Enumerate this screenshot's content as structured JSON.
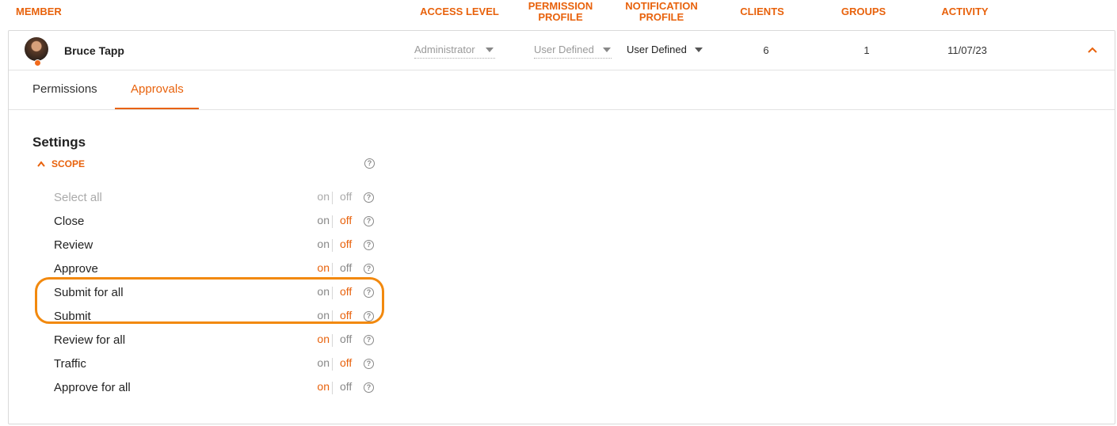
{
  "header": {
    "member": "MEMBER",
    "access_level": "ACCESS LEVEL",
    "permission_profile_1": "PERMISSION",
    "permission_profile_2": "PROFILE",
    "notification_profile_1": "NOTIFICATION",
    "notification_profile_2": "PROFILE",
    "clients": "CLIENTS",
    "groups": "GROUPS",
    "activity": "ACTIVITY"
  },
  "member": {
    "name": "Bruce Tapp",
    "access_level": "Administrator",
    "permission_profile": "User Defined",
    "notification_profile": "User Defined",
    "clients": "6",
    "groups": "1",
    "activity": "11/07/23"
  },
  "tabs": [
    {
      "label": "Permissions",
      "active": false
    },
    {
      "label": "Approvals",
      "active": true
    }
  ],
  "settings": {
    "title": "Settings",
    "scope_label": "SCOPE",
    "on_label": "on",
    "off_label": "off",
    "items": [
      {
        "label": "Select all",
        "state": "none"
      },
      {
        "label": "Close",
        "state": "off"
      },
      {
        "label": "Review",
        "state": "off"
      },
      {
        "label": "Approve",
        "state": "on"
      },
      {
        "label": "Submit for all",
        "state": "off"
      },
      {
        "label": "Submit",
        "state": "off"
      },
      {
        "label": "Review for all",
        "state": "on"
      },
      {
        "label": "Traffic",
        "state": "off"
      },
      {
        "label": "Approve for all",
        "state": "on"
      }
    ]
  },
  "colors": {
    "accent": "#e8620c",
    "highlight_outline": "#f2890e"
  },
  "icons": {
    "help": "question-circle-icon",
    "collapse": "chevron-up-icon",
    "dropdown": "caret-down-icon"
  }
}
